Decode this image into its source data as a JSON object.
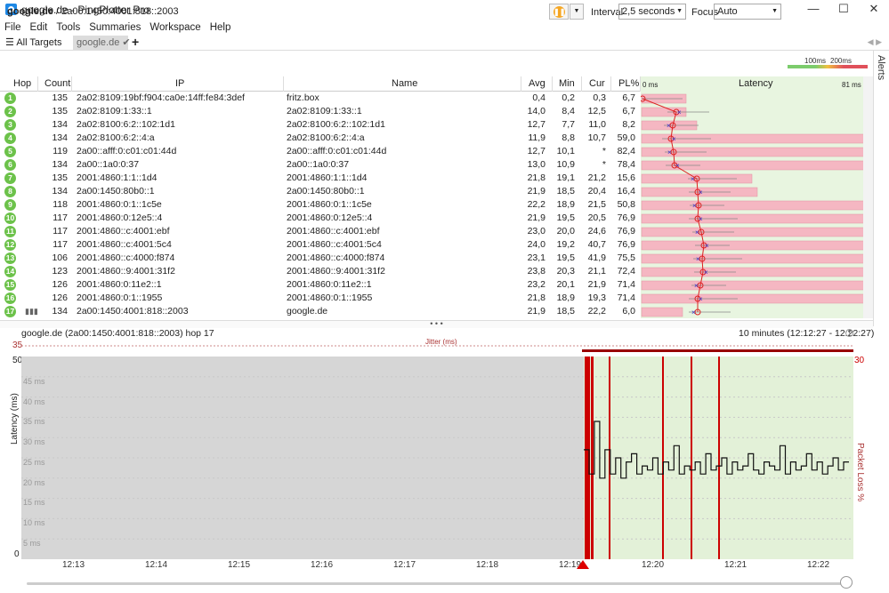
{
  "window": {
    "title": "google.de - PingPlotter Pro",
    "minimize": "—",
    "maximize": "☐",
    "close": "✕"
  },
  "menu": [
    "File",
    "Edit",
    "Tools",
    "Summaries",
    "Workspace",
    "Help"
  ],
  "tabs": {
    "all_targets": "All Targets",
    "active": "google.de",
    "add": "+"
  },
  "target": {
    "host": "google.de",
    "sep": " / ",
    "ip": "2a00:1450:4001:818::2003"
  },
  "controls": {
    "interval_label": "Interval",
    "interval_value": "2,5 seconds",
    "focus_label": "Focus",
    "focus_value": "Auto",
    "scale_100": "100ms",
    "scale_200": "200ms",
    "alerts": "Alerts"
  },
  "grid": {
    "headers": {
      "hop": "Hop",
      "count": "Count",
      "ip": "IP",
      "name": "Name",
      "avg": "Avg",
      "min": "Min",
      "cur": "Cur",
      "pl": "PL%",
      "latency": "Latency"
    },
    "latency_min": "0 ms",
    "latency_max": "81 ms",
    "rows": [
      {
        "hop": "1",
        "count": "135",
        "ip": "2a02:8109:19bf:f904:ca0e:14ff:fe84:3def",
        "name": "fritz.box",
        "avg": "0,4",
        "min": "0,2",
        "cur": "0,3",
        "pl": "6,7"
      },
      {
        "hop": "2",
        "count": "135",
        "ip": "2a02:8109:1:33::1",
        "name": "2a02:8109:1:33::1",
        "avg": "14,0",
        "min": "8,4",
        "cur": "12,5",
        "pl": "6,7"
      },
      {
        "hop": "3",
        "count": "134",
        "ip": "2a02:8100:6:2::102:1d1",
        "name": "2a02:8100:6:2::102:1d1",
        "avg": "12,7",
        "min": "7,7",
        "cur": "11,0",
        "pl": "8,2"
      },
      {
        "hop": "4",
        "count": "134",
        "ip": "2a02:8100:6:2::4:a",
        "name": "2a02:8100:6:2::4:a",
        "avg": "11,9",
        "min": "8,8",
        "cur": "10,7",
        "pl": "59,0"
      },
      {
        "hop": "5",
        "count": "119",
        "ip": "2a00::afff:0:c01:c01:44d",
        "name": "2a00::afff:0:c01:c01:44d",
        "avg": "12,7",
        "min": "10,1",
        "cur": "*",
        "pl": "82,4"
      },
      {
        "hop": "6",
        "count": "134",
        "ip": "2a00::1a0:0:37",
        "name": "2a00::1a0:0:37",
        "avg": "13,0",
        "min": "10,9",
        "cur": "*",
        "pl": "78,4"
      },
      {
        "hop": "7",
        "count": "135",
        "ip": "2001:4860:1:1::1d4",
        "name": "2001:4860:1:1::1d4",
        "avg": "21,8",
        "min": "19,1",
        "cur": "21,2",
        "pl": "15,6"
      },
      {
        "hop": "8",
        "count": "134",
        "ip": "2a00:1450:80b0::1",
        "name": "2a00:1450:80b0::1",
        "avg": "21,9",
        "min": "18,5",
        "cur": "20,4",
        "pl": "16,4"
      },
      {
        "hop": "9",
        "count": "118",
        "ip": "2001:4860:0:1::1c5e",
        "name": "2001:4860:0:1::1c5e",
        "avg": "22,2",
        "min": "18,9",
        "cur": "21,5",
        "pl": "50,8"
      },
      {
        "hop": "10",
        "count": "117",
        "ip": "2001:4860:0:12e5::4",
        "name": "2001:4860:0:12e5::4",
        "avg": "21,9",
        "min": "19,5",
        "cur": "20,5",
        "pl": "76,9"
      },
      {
        "hop": "11",
        "count": "117",
        "ip": "2001:4860::c:4001:ebf",
        "name": "2001:4860::c:4001:ebf",
        "avg": "23,0",
        "min": "20,0",
        "cur": "24,6",
        "pl": "76,9"
      },
      {
        "hop": "12",
        "count": "117",
        "ip": "2001:4860::c:4001:5c4",
        "name": "2001:4860::c:4001:5c4",
        "avg": "24,0",
        "min": "19,2",
        "cur": "40,7",
        "pl": "76,9"
      },
      {
        "hop": "13",
        "count": "106",
        "ip": "2001:4860::c:4000:f874",
        "name": "2001:4860::c:4000:f874",
        "avg": "23,1",
        "min": "19,5",
        "cur": "41,9",
        "pl": "75,5"
      },
      {
        "hop": "14",
        "count": "123",
        "ip": "2001:4860::9:4001:31f2",
        "name": "2001:4860::9:4001:31f2",
        "avg": "23,8",
        "min": "20,3",
        "cur": "21,1",
        "pl": "72,4"
      },
      {
        "hop": "15",
        "count": "126",
        "ip": "2001:4860:0:11e2::1",
        "name": "2001:4860:0:11e2::1",
        "avg": "23,2",
        "min": "20,1",
        "cur": "21,9",
        "pl": "71,4"
      },
      {
        "hop": "16",
        "count": "126",
        "ip": "2001:4860:0:1::1955",
        "name": "2001:4860:0:1::1955",
        "avg": "21,8",
        "min": "18,9",
        "cur": "19,3",
        "pl": "71,4"
      },
      {
        "hop": "17",
        "count": "134",
        "ip": "2a00:1450:4001:818::2003",
        "name": "google.de",
        "avg": "21,9",
        "min": "18,5",
        "cur": "22,2",
        "pl": "6,0"
      }
    ]
  },
  "graph": {
    "title": "google.de (2a00:1450:4001:818::2003) hop 17",
    "range": "10 minutes (12:12:27 - 12:22:27)",
    "jitter_label": "Jitter (ms)",
    "y_top": "50",
    "y_jitter": "35",
    "y_bottom": "0",
    "pl_top": "30",
    "ylabel": "Latency (ms)",
    "ylabel_right": "Packet Loss %",
    "ms_labels": [
      "45 ms",
      "40 ms",
      "35 ms",
      "30 ms",
      "25 ms",
      "20 ms",
      "15 ms",
      "10 ms",
      "5 ms"
    ],
    "x_ticks": [
      "12:13",
      "12:14",
      "12:15",
      "12:16",
      "12:17",
      "12:18",
      "12:19",
      "12:20",
      "12:21",
      "12:22"
    ]
  },
  "chart_data": {
    "type": "line",
    "title": "google.de (2a00:1450:4001:818::2003) hop 17",
    "xlabel": "",
    "ylabel": "Latency (ms)",
    "ylim": [
      0,
      50
    ],
    "series": [
      {
        "values": [
          27,
          21,
          34,
          20,
          27,
          21,
          25,
          20,
          24,
          26,
          21,
          23,
          22,
          25,
          21,
          24,
          22,
          28,
          21,
          23,
          22,
          24,
          21,
          26,
          22,
          23,
          25,
          21,
          24,
          22,
          23,
          26,
          22,
          21,
          24,
          23,
          22,
          28,
          21,
          24,
          22,
          23,
          26,
          22,
          24,
          21,
          23,
          25,
          22,
          24
        ]
      }
    ],
    "packet_loss_events": [
      "12:19",
      "12:20",
      "12:20",
      "12:21"
    ]
  },
  "colors": {
    "hop_ok": "#6cc24a",
    "loss_bar": "#f3b6c0",
    "latency_bg": "#e8f5e0",
    "loss_line": "#cc0000"
  }
}
